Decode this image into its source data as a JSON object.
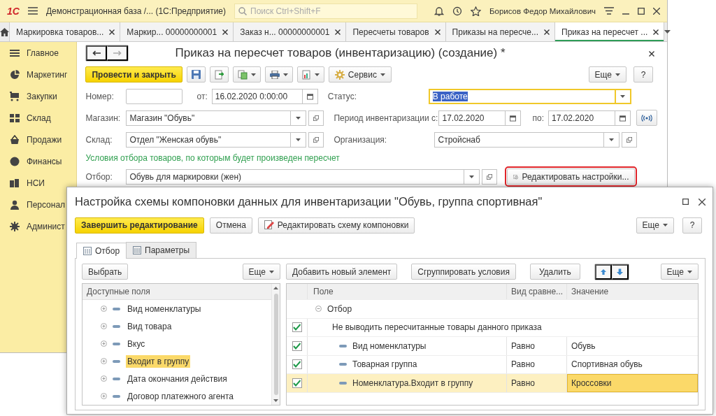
{
  "app": {
    "logo": "1С",
    "title": "Демонстрационная база /...  (1С:Предприятие)",
    "search_placeholder": "Поиск Ctrl+Shift+F",
    "user": "Борисов Федор Михайлович"
  },
  "tabs": [
    {
      "label": "Маркировка товаров...",
      "selected": false
    },
    {
      "label": "Маркир... 00000000001",
      "selected": false
    },
    {
      "label": "Заказ н... 00000000001",
      "selected": false
    },
    {
      "label": "Пересчеты товаров",
      "selected": false
    },
    {
      "label": "Приказы на пересче...",
      "selected": false
    },
    {
      "label": "Приказ на пересчет ...",
      "selected": true
    }
  ],
  "sidebar": {
    "items": [
      "Главное",
      "Маркетинг",
      "Закупки",
      "Склад",
      "Продажи",
      "Финансы",
      "НСИ",
      "Персонал",
      "Админист"
    ]
  },
  "form": {
    "title": "Приказ на пересчет товаров (инвентаризацию) (создание) *",
    "toolbar": {
      "primary": "Провести и закрыть",
      "service": "Сервис",
      "more": "Еще",
      "help": "?"
    },
    "number": {
      "label": "Номер:"
    },
    "date": {
      "label": "от:",
      "value": "16.02.2020  0:00:00"
    },
    "status": {
      "label": "Статус:",
      "value": "В работе",
      "highlighted": true
    },
    "store": {
      "label": "Магазин:",
      "value": "Магазин \"Обувь\""
    },
    "period_from": {
      "label": "Период инвентаризации с:",
      "value": "17.02.2020"
    },
    "period_to": {
      "label": "по:",
      "value": "17.02.2020"
    },
    "warehouse": {
      "label": "Склад:",
      "value": "Отдел \"Женская обувь\""
    },
    "organization": {
      "label": "Организация:",
      "value": "Стройснаб"
    },
    "hint": "Условия отбора товаров, по которым будет произведен пересчет",
    "filter": {
      "label": "Отбор:",
      "value": "Обувь для маркировки (жен)"
    },
    "edit_settings": {
      "label": "Редактировать настройки...",
      "highlighted": true
    }
  },
  "dialog": {
    "title": "Настройка схемы компоновки данных для инвентаризации \"Обувь, группа спортивная\"",
    "buttons": {
      "finish": "Завершить редактирование",
      "cancel": "Отмена",
      "edit_scheme": "Редактировать схему компоновки",
      "more": "Еще",
      "help": "?"
    },
    "tabs": [
      {
        "label": "Отбор",
        "selected": true
      },
      {
        "label": "Параметры",
        "selected": false
      }
    ],
    "left_toolbar": {
      "select": "Выбрать",
      "more": "Еще"
    },
    "fields": {
      "header": "Доступные поля",
      "items": [
        {
          "label": "Вид номенклатуры",
          "expanded": false,
          "selected": false
        },
        {
          "label": "Вид товара",
          "expanded": false,
          "selected": false
        },
        {
          "label": "Вкус",
          "expanded": false,
          "selected": false
        },
        {
          "label": "Входит в группу",
          "expanded": false,
          "selected": true
        },
        {
          "label": "Дата окончания действия",
          "expanded": false,
          "selected": false
        },
        {
          "label": "Договор платежного агента",
          "expanded": false,
          "selected": false
        }
      ]
    },
    "right_toolbar": {
      "add": "Добавить новый элемент",
      "group": "Сгруппировать условия",
      "delete": "Удалить",
      "more": "Еще"
    },
    "table": {
      "columns": [
        "Поле",
        "Вид сравне...",
        "Значение"
      ],
      "rows": [
        {
          "kind": "group",
          "field": "Отбор",
          "expanded": true
        },
        {
          "kind": "preset",
          "field": "Не выводить пересчитанные товары данного приказа",
          "checked": true,
          "selected": false
        },
        {
          "kind": "field",
          "field": "Вид номенклатуры",
          "comparison": "Равно",
          "value": "Обувь",
          "checked": true,
          "selected": false
        },
        {
          "kind": "field",
          "field": "Товарная группа",
          "comparison": "Равно",
          "value": "Спортивная обувь",
          "checked": true,
          "selected": false
        },
        {
          "kind": "field",
          "field": "Номенклатура.Входит в группу",
          "comparison": "Равно",
          "value": "Кроссовки",
          "checked": true,
          "selected": true
        }
      ]
    }
  }
}
